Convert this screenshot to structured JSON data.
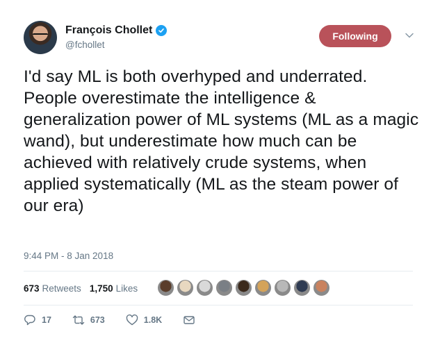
{
  "tweet": {
    "author": {
      "name": "François Chollet",
      "handle": "@fchollet",
      "verified_icon": "verified-badge-icon"
    },
    "follow_button_label": "Following",
    "more_icon": "chevron-down-icon",
    "text": "I'd say ML is both overhyped and underrated. People overestimate the intelligence & generalization power of ML systems (ML as a magic wand), but underestimate how much can be achieved with relatively crude systems, when applied systematically (ML as the steam power of our era)",
    "timestamp": "9:44 PM - 8 Jan 2018",
    "stats": {
      "retweets_count": "673",
      "retweets_label": "Retweets",
      "likes_count": "1,750",
      "likes_label": "Likes"
    },
    "actions": {
      "replies": "17",
      "retweets": "673",
      "likes": "1.8K"
    }
  },
  "colors": {
    "following_button": "#b9525a",
    "verified": "#1da1f2",
    "muted_text": "#657786"
  },
  "likers": [
    {
      "icon": "liker-avatar-icon",
      "color": "#5a3d2b"
    },
    {
      "icon": "liker-avatar-icon",
      "color": "#e8d8c0"
    },
    {
      "icon": "liker-avatar-icon",
      "color": "#d9d9d9"
    },
    {
      "icon": "liker-avatar-icon",
      "color": "#7a7f85"
    },
    {
      "icon": "liker-avatar-icon",
      "color": "#3b2a1c"
    },
    {
      "icon": "liker-avatar-icon",
      "color": "#d4a35a"
    },
    {
      "icon": "liker-avatar-icon",
      "color": "#b8b8b8"
    },
    {
      "icon": "liker-avatar-icon",
      "color": "#2f3b52"
    },
    {
      "icon": "liker-avatar-icon",
      "color": "#c9825f"
    }
  ]
}
